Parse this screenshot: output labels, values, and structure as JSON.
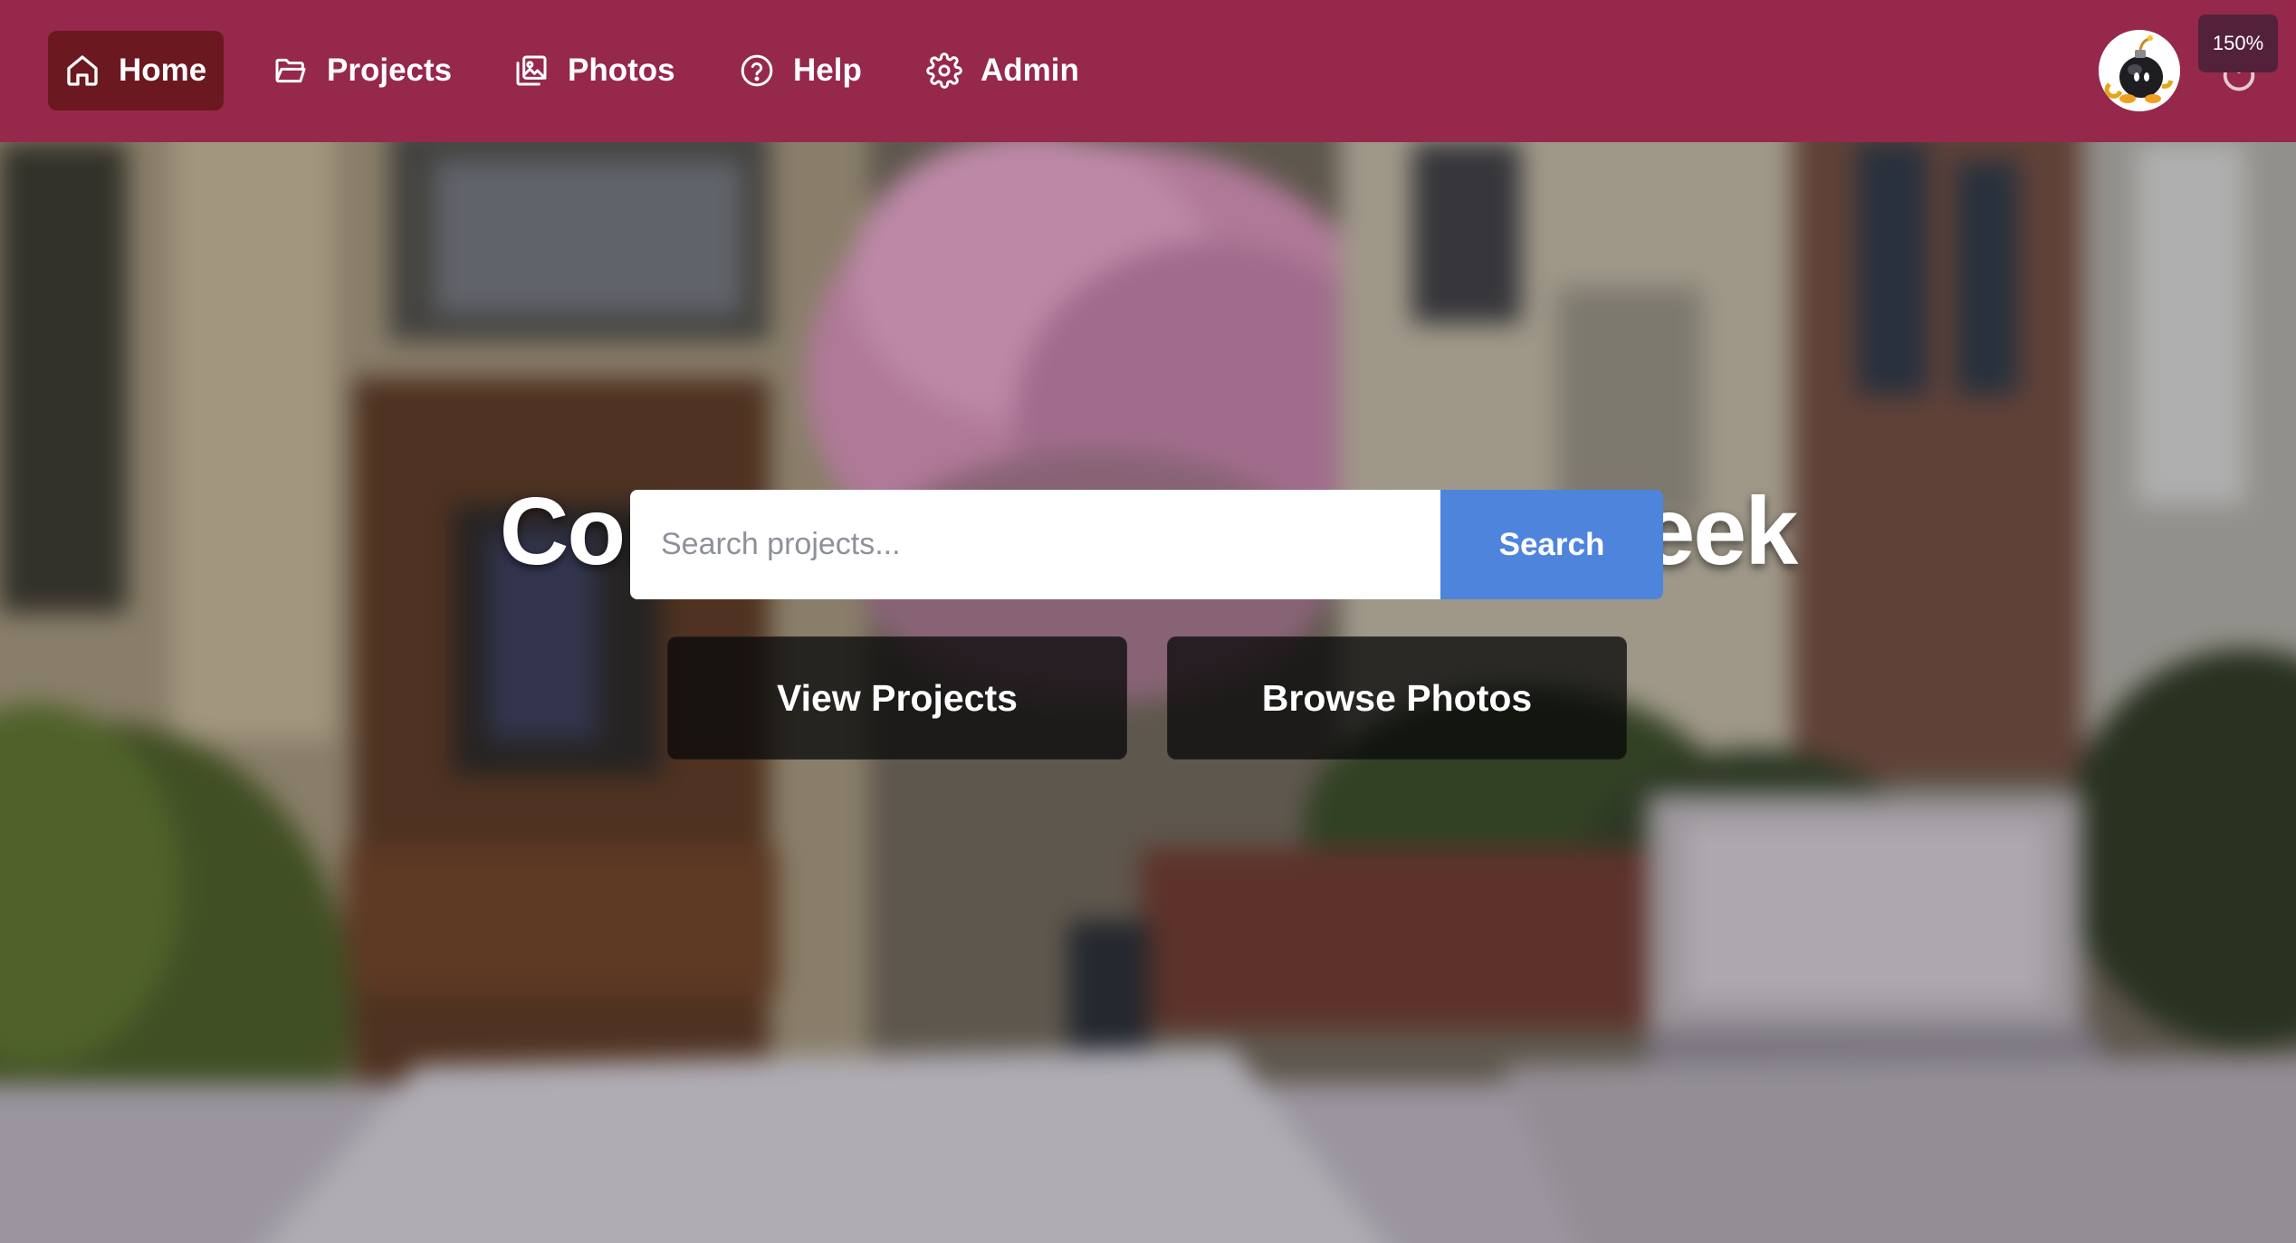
{
  "nav": {
    "items": [
      {
        "label": "Home",
        "icon": "home-icon",
        "active": true
      },
      {
        "label": "Projects",
        "icon": "folder-icon",
        "active": false
      },
      {
        "label": "Photos",
        "icon": "photos-icon",
        "active": false
      },
      {
        "label": "Help",
        "icon": "help-circle-icon",
        "active": false
      },
      {
        "label": "Admin",
        "icon": "gear-icon",
        "active": false
      }
    ],
    "avatar_icon": "bomb-avatar-icon",
    "power_icon": "power-icon"
  },
  "zoom_badge": "150%",
  "hero": {
    "title": "Commonwealth Project Week",
    "search": {
      "placeholder": "Search projects...",
      "button_label": "Search"
    },
    "buttons": {
      "view_projects": "View Projects",
      "browse_photos": "Browse Photos"
    }
  },
  "colors": {
    "navbar": "#95284b",
    "nav_active": "#6b1820",
    "search_button": "#4f84dc",
    "cta_background": "#0a0a0a"
  }
}
